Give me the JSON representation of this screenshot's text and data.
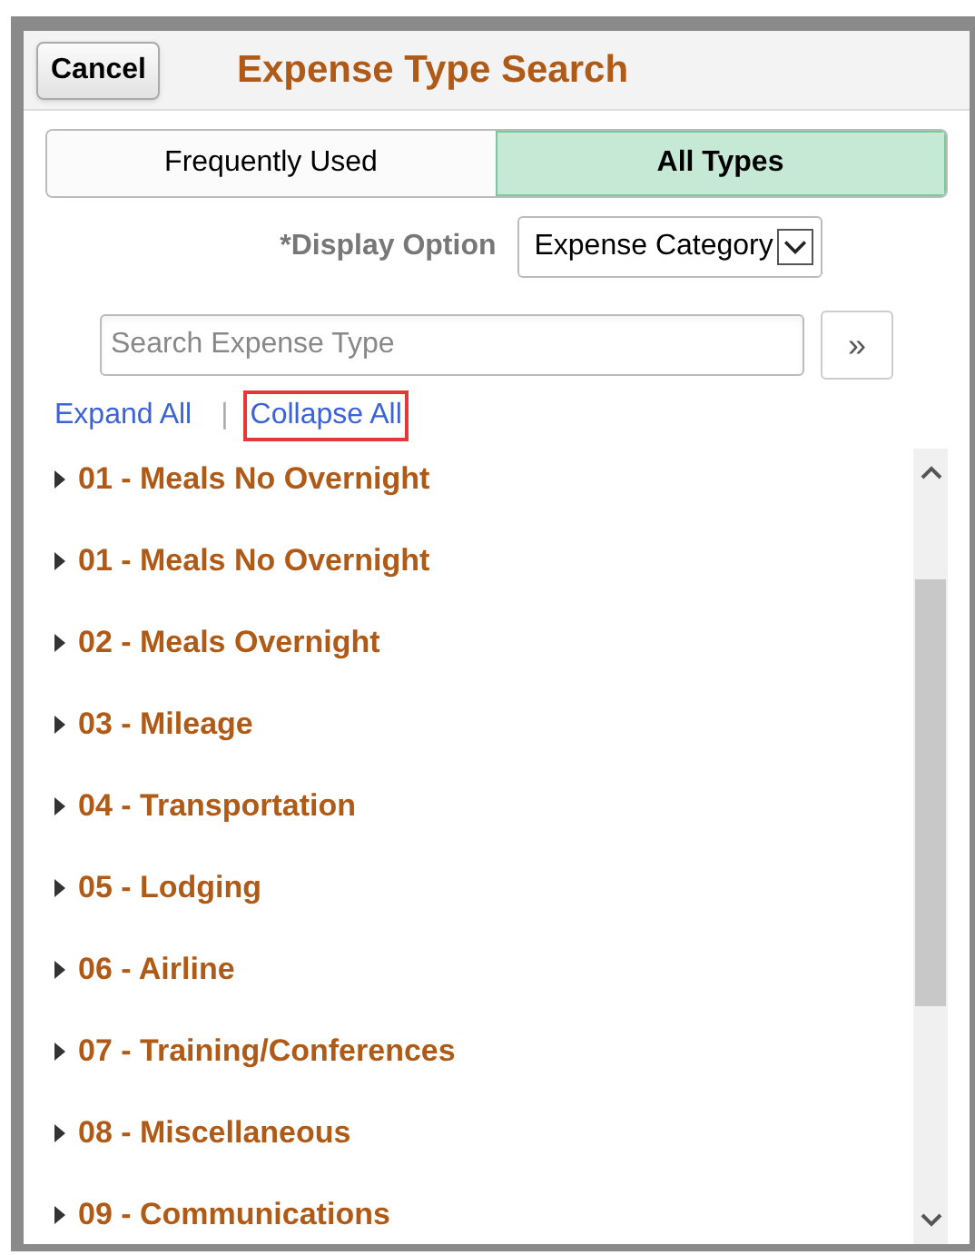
{
  "dialog": {
    "title": "Expense Type Search",
    "cancel": "Cancel"
  },
  "tabs": [
    {
      "label": "Frequently Used",
      "selected": false
    },
    {
      "label": "All Types",
      "selected": true
    }
  ],
  "display_option": {
    "label": "*Display Option",
    "value": "Expense Category"
  },
  "search": {
    "placeholder": "Search Expense Type",
    "button": "»"
  },
  "links": [
    {
      "label": "Expand All",
      "highlighted": false
    },
    {
      "label": "Collapse All",
      "highlighted": true
    }
  ],
  "separator": "|",
  "categories": [
    {
      "label": "01 - Meals No Overnight",
      "expanded": false
    },
    {
      "label": "01 - Meals No Overnight",
      "expanded": false
    },
    {
      "label": "02 - Meals Overnight",
      "expanded": false
    },
    {
      "label": "03 - Mileage",
      "expanded": false
    },
    {
      "label": "04 - Transportation",
      "expanded": false
    },
    {
      "label": "05 - Lodging",
      "expanded": false
    },
    {
      "label": "06 - Airline",
      "expanded": false
    },
    {
      "label": "07 - Training/Conferences",
      "expanded": false
    },
    {
      "label": "08 - Miscellaneous",
      "expanded": false
    },
    {
      "label": "09 - Communications",
      "expanded": false
    }
  ]
}
